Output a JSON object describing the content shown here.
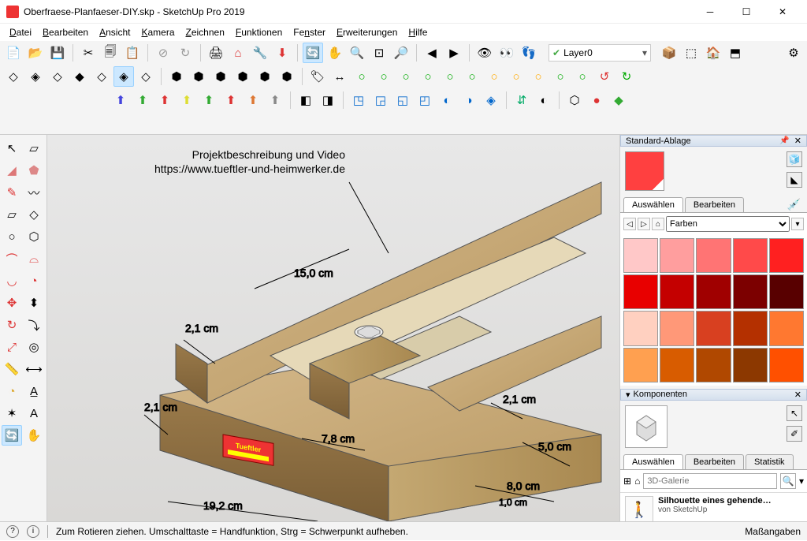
{
  "window": {
    "title": "Oberfraese-Planfaeser-DIY.skp - SketchUp Pro 2019"
  },
  "menu": {
    "datei": "Datei",
    "bearbeiten": "Bearbeiten",
    "ansicht": "Ansicht",
    "kamera": "Kamera",
    "zeichnen": "Zeichnen",
    "funktionen": "Funktionen",
    "fenster": "Fenster",
    "erweiterungen": "Erweiterungen",
    "hilfe": "Hilfe"
  },
  "layer": {
    "label": "Layer0"
  },
  "viewport": {
    "annotation_line1": "Projektbeschreibung und Video",
    "annotation_line2": "https://www.tueftler-und-heimwerker.de",
    "dims": {
      "d1": "15,0 cm",
      "d2": "2,1 cm",
      "d3": "2,1 cm",
      "d4": "7,8 cm",
      "d5": "2,1 cm",
      "d6": "5,0 cm",
      "d7": "8,0 cm",
      "d8": "1,0 cm",
      "d9": "19,2 cm"
    },
    "label_sticker": "Tueftler"
  },
  "panels": {
    "ablage": {
      "title": "Standard-Ablage"
    },
    "materials": {
      "tab_select": "Auswählen",
      "tab_edit": "Bearbeiten",
      "dropdown": "Farben",
      "swatches": [
        "#ffc8c8",
        "#ff9e9e",
        "#ff7474",
        "#ff4a4a",
        "#ff2020",
        "#e80000",
        "#c40000",
        "#a00000",
        "#7c0000",
        "#580000",
        "#ffd0c0",
        "#ff9878",
        "#d84020",
        "#b43000",
        "#ff7830",
        "#ffa050",
        "#d85c00",
        "#b04800",
        "#8c3800",
        "#ff5000"
      ]
    },
    "komponenten": {
      "title": "Komponenten",
      "tab_select": "Auswählen",
      "tab_edit": "Bearbeiten",
      "tab_stats": "Statistik",
      "search_placeholder": "3D-Galerie",
      "item_title": "Silhouette eines gehende…",
      "item_sub": "von SketchUp"
    }
  },
  "status": {
    "hint": "Zum Rotieren ziehen. Umschalttaste = Handfunktion, Strg = Schwerpunkt aufheben.",
    "measurements_label": "Maßangaben"
  }
}
